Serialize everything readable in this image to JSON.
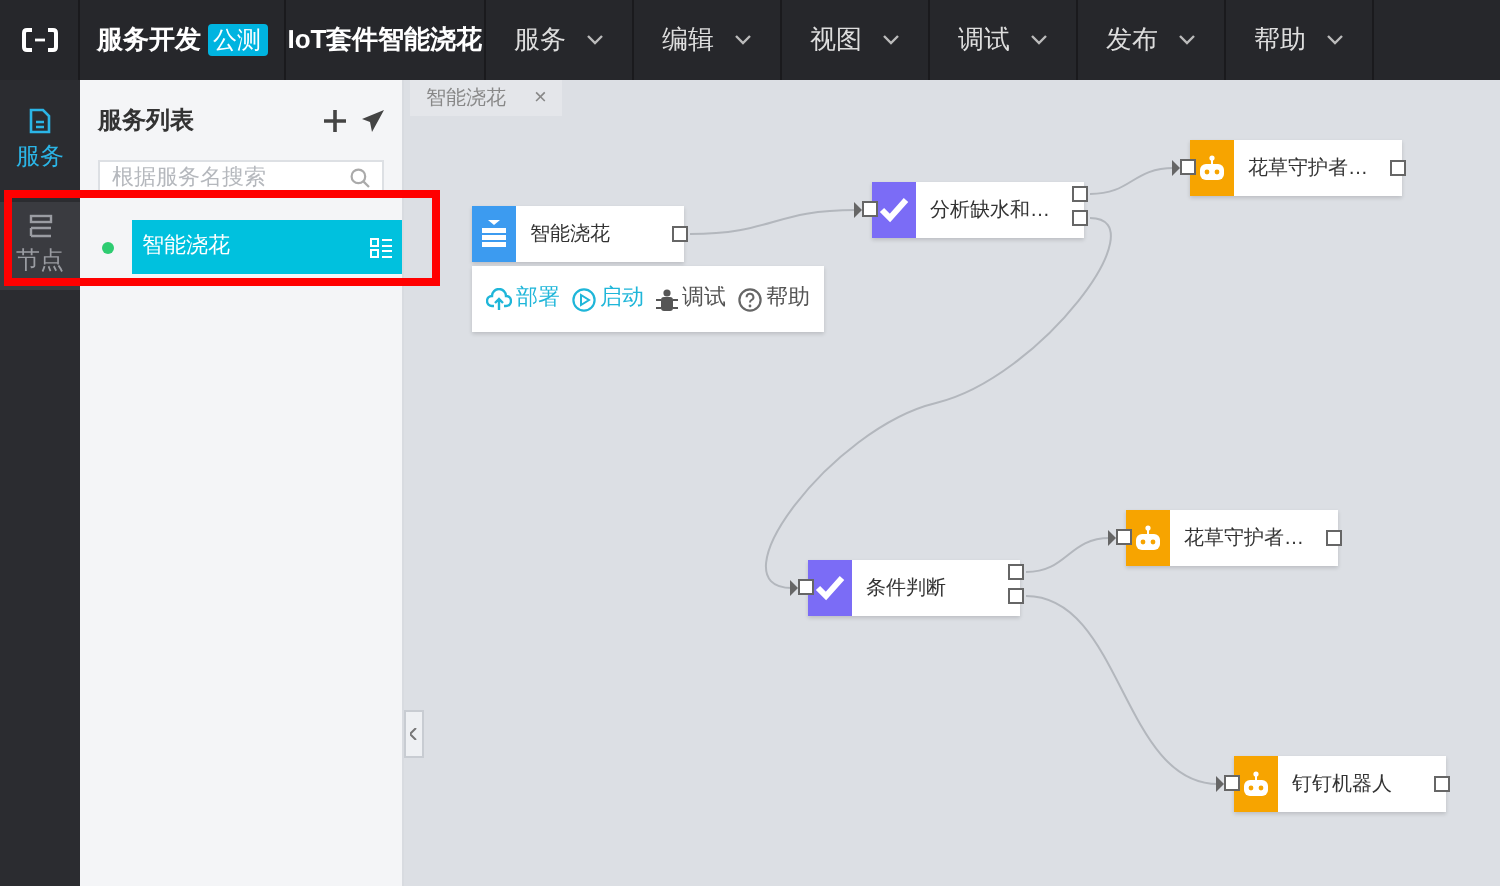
{
  "topbar": {
    "product": "服务开发",
    "badge": "公测",
    "project": "IoT套件智能浇花",
    "menus": [
      "服务",
      "编辑",
      "视图",
      "调试",
      "发布",
      "帮助"
    ]
  },
  "rail": [
    {
      "label": "服务",
      "selected": true
    },
    {
      "label": "节点",
      "selected": false
    }
  ],
  "sidebar": {
    "title": "服务列表",
    "search": {
      "placeholder": "根据服务名搜索"
    },
    "items": [
      {
        "label": "智能浇花",
        "selected": true,
        "color": "#2ecc71"
      }
    ]
  },
  "tabs": [
    {
      "label": "智能浇花",
      "close": "×"
    }
  ],
  "nodes": [
    {
      "kind": "source",
      "label": "智能浇花"
    },
    {
      "kind": "condition",
      "label": "分析缺水和…"
    },
    {
      "kind": "robot",
      "label": "花草守护者…"
    },
    {
      "kind": "condition",
      "label": "条件判断"
    },
    {
      "kind": "robot",
      "label": "花草守护者…"
    },
    {
      "kind": "robot",
      "label": "钉钉机器人"
    }
  ],
  "node_toolbar": [
    {
      "kind": "deploy",
      "label": "部署"
    },
    {
      "kind": "start",
      "label": "启动"
    },
    {
      "kind": "debug",
      "label": "调试"
    },
    {
      "kind": "help",
      "label": "帮助"
    }
  ]
}
